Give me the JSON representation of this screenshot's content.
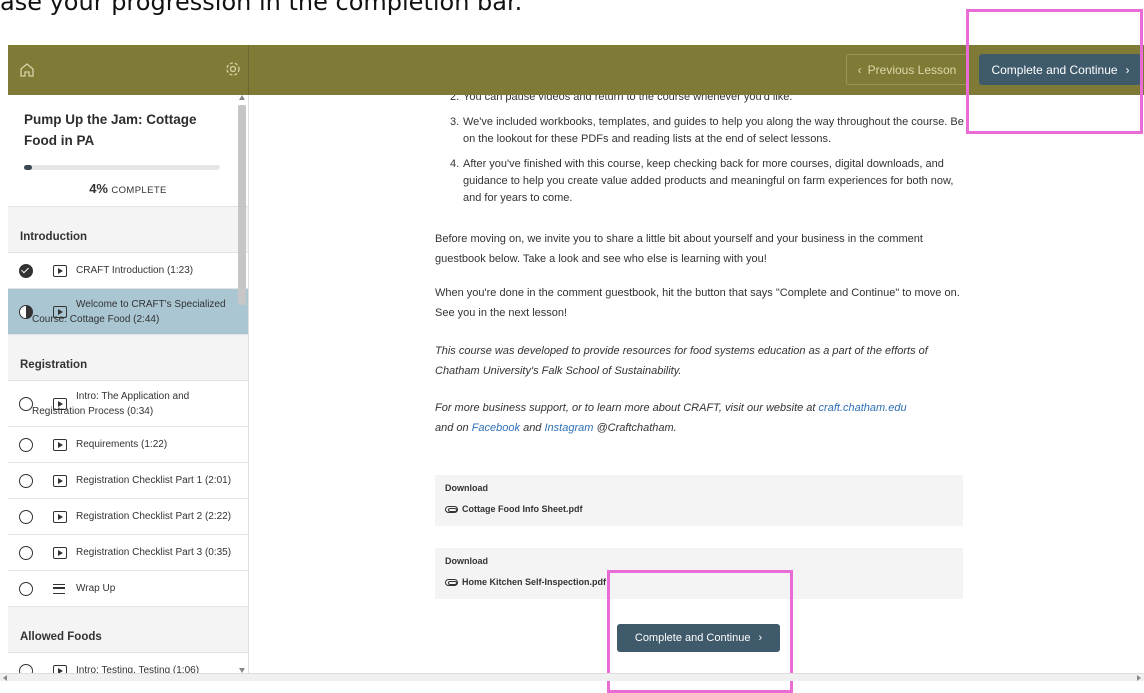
{
  "caption": "ase your progression in the completion bar.",
  "header": {
    "home_icon": "home-icon",
    "settings_icon": "gear-icon",
    "previous_label": "Previous Lesson",
    "next_label": "Complete and Continue"
  },
  "sidebar": {
    "course_title": "Pump Up the Jam: Cottage Food in PA",
    "progress_percent": 4,
    "progress_value": "4%",
    "progress_suffix": "COMPLETE",
    "sections": [
      {
        "title": "Introduction",
        "lessons": [
          {
            "label": "CRAFT Introduction (1:23)",
            "status": "complete",
            "type": "video"
          },
          {
            "label": "Welcome to CRAFT's Specialized Course: Cottage Food (2:44)",
            "status": "in-progress",
            "type": "video",
            "active": true
          }
        ]
      },
      {
        "title": "Registration",
        "lessons": [
          {
            "label": "Intro: The Application and Registration Process (0:34)",
            "status": "incomplete",
            "type": "video"
          },
          {
            "label": "Requirements (1:22)",
            "status": "incomplete",
            "type": "video"
          },
          {
            "label": "Registration Checklist Part 1 (2:01)",
            "status": "incomplete",
            "type": "video"
          },
          {
            "label": "Registration Checklist Part 2 (2:22)",
            "status": "incomplete",
            "type": "video"
          },
          {
            "label": "Registration Checklist Part 3 (0:35)",
            "status": "incomplete",
            "type": "video"
          },
          {
            "label": "Wrap Up",
            "status": "incomplete",
            "type": "text"
          }
        ]
      },
      {
        "title": "Allowed Foods",
        "lessons": [
          {
            "label": "Intro: Testing, Testing (1:06)",
            "status": "incomplete",
            "type": "video"
          }
        ]
      }
    ]
  },
  "main": {
    "list_items": [
      {
        "num": "2.",
        "text": "You can pause videos and return to the course whenever you'd like."
      },
      {
        "num": "3.",
        "text": "We've included workbooks, templates, and guides to help you along the way throughout the course. Be on the lookout for these PDFs and reading lists at the end of select lessons."
      },
      {
        "num": "4.",
        "text": "After you've finished with this course, keep checking back for more courses, digital downloads, and guidance to help you create value added products and meaningful on farm experiences for both now, and for years to come."
      }
    ],
    "para1": "Before moving on, we invite you to share a little bit about yourself and your business in the comment guestbook below. Take a look and see who else is learning with you!",
    "para2": "When you're done in the comment guestbook, hit the button that says \"Complete and Continue\" to move on. See you in the next lesson!",
    "para3": "This course was developed to provide resources for food systems education as a part of the efforts of Chatham University's Falk School of Sustainability.",
    "para4_a": "For more business support, or to learn more about CRAFT, visit our website at ",
    "para4_link1": "craft.chatham.edu",
    "para4_b": " and on ",
    "para4_link2": "Facebook",
    "para4_c": " and ",
    "para4_link3": "Instagram",
    "para4_d": " @Craftchatham.",
    "downloads": [
      {
        "label": "Download",
        "file": "Cottage Food Info Sheet.pdf"
      },
      {
        "label": "Download",
        "file": "Home Kitchen Self-Inspection.pdf"
      }
    ],
    "next_label": "Complete and Continue"
  },
  "colors": {
    "header": "#7f7a36",
    "primary_button": "#3f5a6a",
    "active_lesson": "#a9c6d2",
    "highlight": "#e96bd5",
    "link": "#2f6fb5"
  }
}
